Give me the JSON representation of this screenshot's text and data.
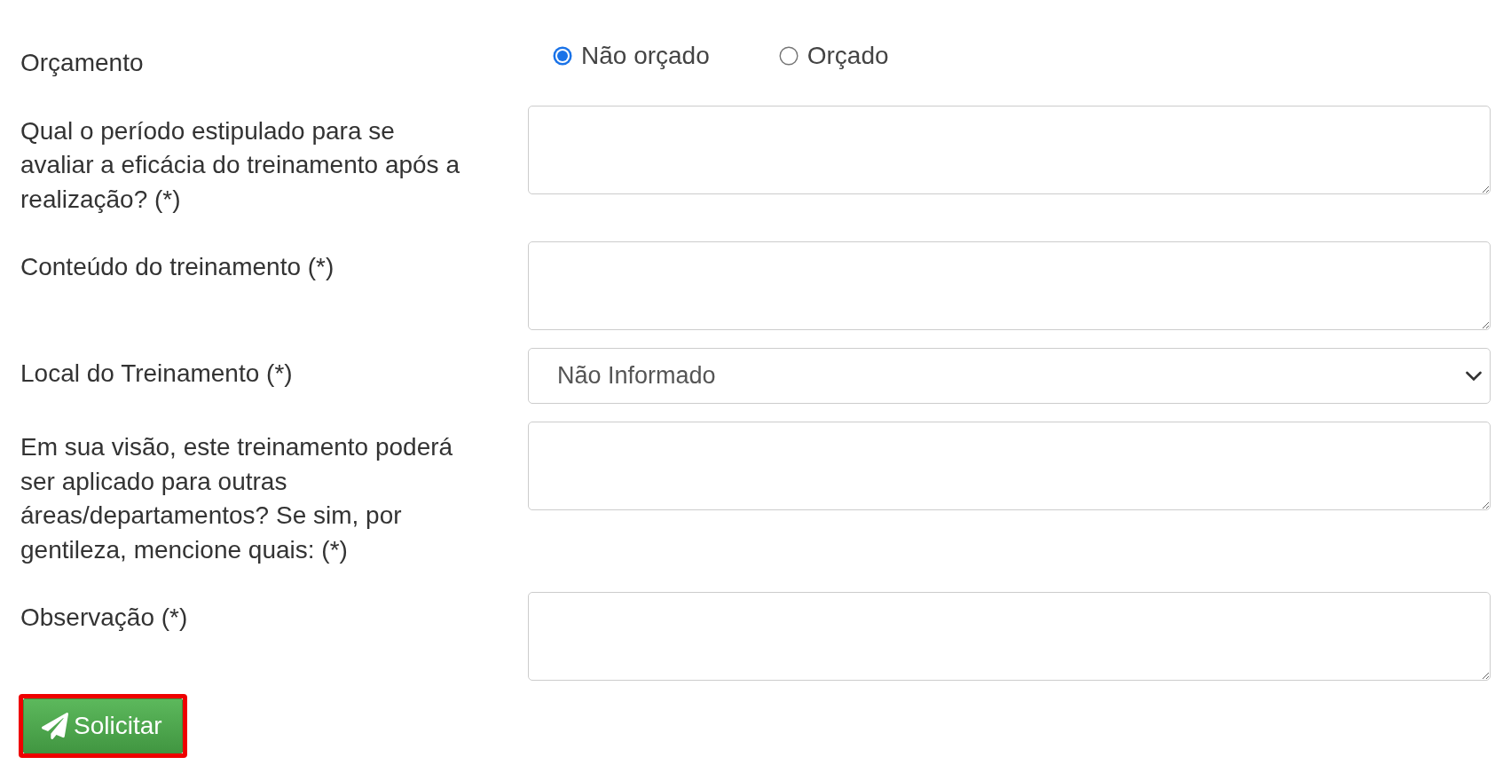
{
  "form": {
    "rows": [
      {
        "kind": "radio",
        "label": "Orçamento",
        "options": [
          {
            "label": "Não orçado",
            "selected": true
          },
          {
            "label": "Orçado",
            "selected": false
          }
        ]
      },
      {
        "kind": "textarea",
        "label": "Qual o período estipulado para se avaliar a eficácia do treinamento após a realização? (*)"
      },
      {
        "kind": "textarea",
        "label": "Conteúdo do treinamento (*)"
      },
      {
        "kind": "select",
        "label": "Local do Treinamento (*)",
        "value": "Não Informado"
      },
      {
        "kind": "textarea",
        "label": "Em sua visão, este treinamento poderá ser aplicado para outras áreas/departamentos? Se sim, por gentileza, mencione quais: (*)"
      },
      {
        "kind": "textarea",
        "label": "Observação (*)"
      }
    ]
  },
  "submit_button": {
    "label": "Solicitar",
    "highlighted": true
  }
}
